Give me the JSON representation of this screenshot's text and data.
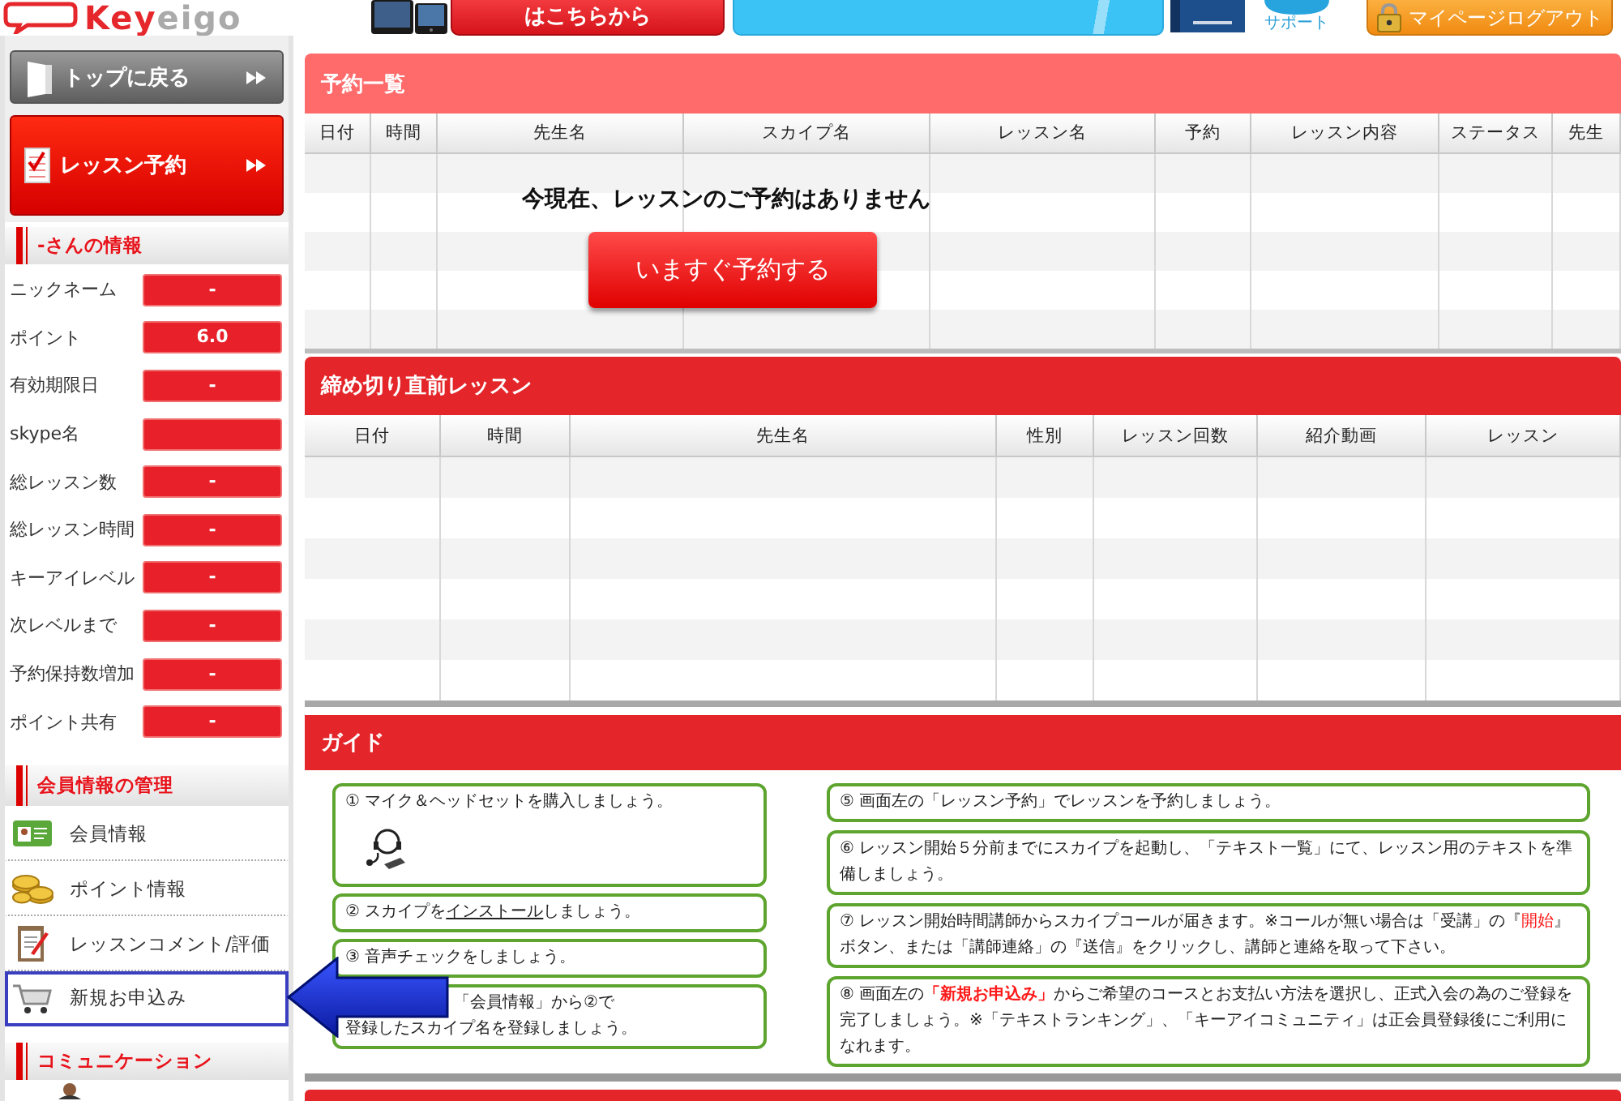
{
  "header": {
    "logo_parts": [
      "Key",
      "eigo"
    ],
    "items": [
      {
        "kind": "devices",
        "label": "はこちらから"
      },
      {
        "kind": "banner"
      },
      {
        "kind": "manual"
      },
      {
        "kind": "support",
        "label": "サポート"
      },
      {
        "kind": "logout",
        "label": "マイページログアウト"
      }
    ]
  },
  "sidebar": {
    "nav_buttons": [
      {
        "kind": "top",
        "label": "トップに戻る"
      },
      {
        "kind": "reserve",
        "label": "レッスン予約"
      }
    ],
    "profile": {
      "title": "-さんの情報",
      "rows": [
        {
          "label": "ニックネーム",
          "value": "-"
        },
        {
          "label": "ポイント",
          "value": "6.0"
        },
        {
          "label": "有効期限日",
          "value": "-"
        },
        {
          "label": "skype名"
        },
        {
          "label": "総レッスン数",
          "value": "-"
        },
        {
          "label": "総レッスン時間",
          "value": "-"
        },
        {
          "label": "キーアイレベル",
          "value": "-"
        },
        {
          "label": "次レベルまで",
          "value": "-"
        },
        {
          "label": "予約保持数増加",
          "value": "-"
        },
        {
          "label": "ポイント共有",
          "value": "-"
        }
      ]
    },
    "member_menu": {
      "title": "会員情報の管理",
      "items": [
        {
          "kind": "card",
          "label": "会員情報",
          "highlighted": false
        },
        {
          "kind": "coins",
          "label": "ポイント情報",
          "highlighted": false
        },
        {
          "kind": "clipboard",
          "label": "レッスンコメント/評価",
          "highlighted": false
        },
        {
          "kind": "cart",
          "label": "新規お申込み",
          "highlighted": true
        }
      ]
    },
    "community": {
      "title": "コミュニケーション"
    }
  },
  "reservations": {
    "title": "予約一覧",
    "columns": [
      "日付",
      "時間",
      "先生名",
      "スカイプ名",
      "レッスン名",
      "予約",
      "レッスン内容",
      "ステータス",
      "先生"
    ],
    "empty_message": "今現在、レッスンのご予約はありません",
    "reserve_button": "いますぐ予約する"
  },
  "deadline_lessons": {
    "title": "締め切り直前レッスン",
    "columns": [
      "日付",
      "時間",
      "先生名",
      "性別",
      "レッスン回数",
      "紹介動画",
      "レッスン"
    ]
  },
  "guide": {
    "title": "ガイド",
    "columns": [
      [
        {
          "kind": "headset",
          "parts": [
            {
              "kind": "plain",
              "text": "① マイク＆ヘッドセットを購入しましょう。"
            }
          ]
        },
        {
          "kind": "text",
          "parts": [
            {
              "kind": "plain",
              "text": "② スカイプを"
            },
            {
              "kind": "link",
              "text": "インストール"
            },
            {
              "kind": "plain",
              "text": "しましょう。"
            }
          ]
        },
        {
          "kind": "text",
          "parts": [
            {
              "kind": "plain",
              "text": "③ 音声チェックをしましょう。"
            }
          ]
        },
        {
          "kind": "covered",
          "parts": [
            {
              "kind": "line",
              "text": "「会員情報」から②で"
            },
            {
              "kind": "line",
              "text": "登録したスカイプ名を登録しましょう。"
            }
          ]
        }
      ],
      [
        {
          "kind": "text",
          "parts": [
            {
              "kind": "plain",
              "text": "⑤ 画面左の「レッスン予約」でレッスンを予約しましょう。"
            }
          ]
        },
        {
          "kind": "text",
          "parts": [
            {
              "kind": "plain",
              "text": "⑥ レッスン開始５分前までにスカイプを起動し、「テキスト一覧」にて、レッスン用のテキストを準備しましょう。"
            }
          ]
        },
        {
          "kind": "text",
          "parts": [
            {
              "kind": "plain",
              "text": "⑦ レッスン開始時間講師からスカイプコールが届きます。※コールが無い場合は「受講」の『"
            },
            {
              "kind": "emphasis",
              "text": "開始"
            },
            {
              "kind": "plain",
              "text": "』ボタン、または「講師連絡」の『送信』をクリックし、講師と連絡を取って下さい。"
            }
          ]
        },
        {
          "kind": "text",
          "parts": [
            {
              "kind": "plain",
              "text": "⑧ 画面左の"
            },
            {
              "kind": "strong-emphasis",
              "text": "「新規お申込み」"
            },
            {
              "kind": "plain",
              "text": "からご希望のコースとお支払い方法を選択し、正式入会の為のご登録を完了しましょう。※「テキストランキング」、「キーアイコミュニティ」は正会員登録後にご利用になれます。"
            }
          ]
        }
      ]
    ]
  },
  "annotation": {
    "arrow": true
  }
}
